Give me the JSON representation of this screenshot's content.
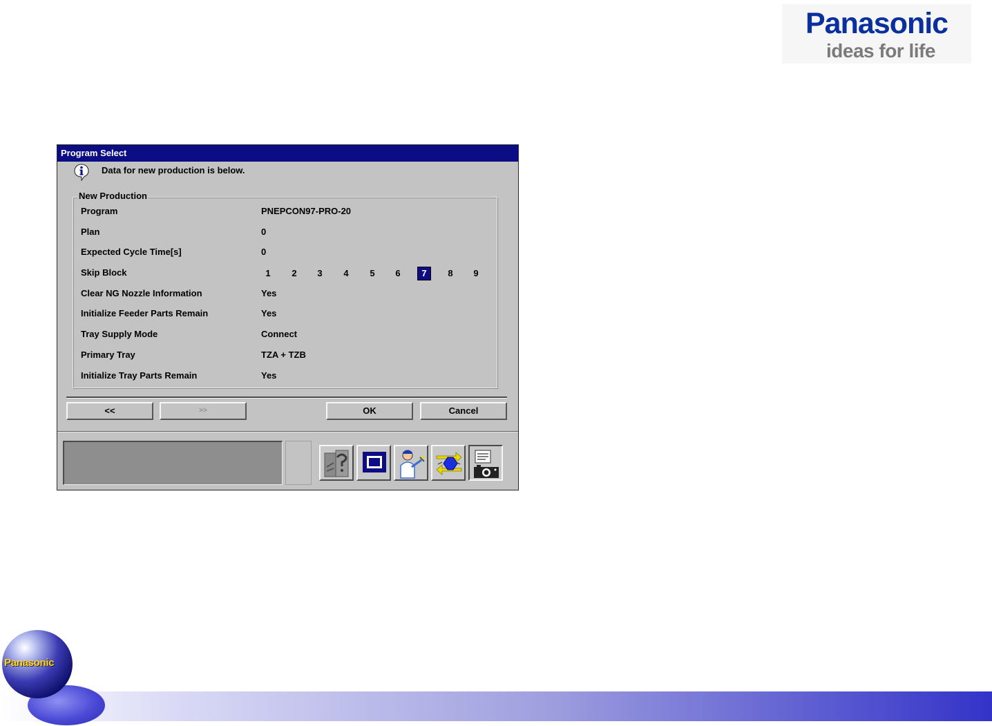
{
  "brand": {
    "logo_text": "Panasonic",
    "tagline": "ideas for life",
    "globe_text": "Panasonic",
    "logo_color": "#0a2f9e"
  },
  "dialog": {
    "title": "Program Select",
    "info_message": "Data for new production is below.",
    "group_title": "New Production",
    "fields": [
      {
        "label": "Program",
        "value": "PNEPCON97-PRO-20"
      },
      {
        "label": "Plan",
        "value": "0"
      },
      {
        "label": "Expected Cycle Time[s]",
        "value": "0"
      },
      {
        "label": "Skip Block",
        "value": ""
      },
      {
        "label": "Clear NG Nozzle Information",
        "value": "Yes"
      },
      {
        "label": "Initialize Feeder Parts Remain",
        "value": "Yes"
      },
      {
        "label": "Tray Supply Mode",
        "value": "Connect"
      },
      {
        "label": "Primary Tray",
        "value": "TZA + TZB"
      },
      {
        "label": "Initialize Tray Parts Remain",
        "value": "Yes"
      }
    ],
    "skip_blocks": [
      "1",
      "2",
      "3",
      "4",
      "5",
      "6",
      "7",
      "8",
      "9"
    ],
    "skip_block_selected": "7",
    "buttons": {
      "prev": "<<",
      "next": ">>",
      "ok": "OK",
      "cancel": "Cancel"
    },
    "toolbar_icons": [
      "help-manual-icon",
      "monitor-screen-icon",
      "operator-icon",
      "data-transfer-icon",
      "camera-info-icon"
    ],
    "title_bar_color": "#0c0c84"
  }
}
